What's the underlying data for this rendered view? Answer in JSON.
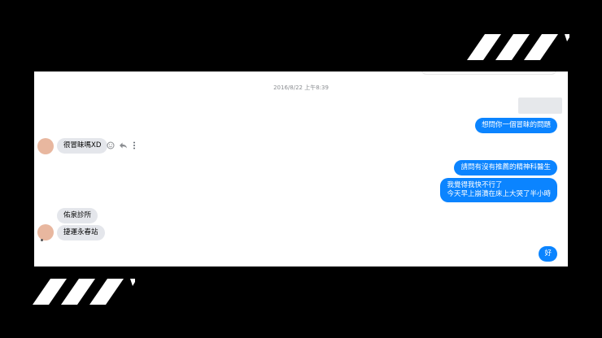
{
  "chat": {
    "timestamp": "2016/8/22 上午8:39",
    "messages": {
      "out1": "想問你一個冒昧的問題",
      "in1": "很冒昧嗎XD",
      "out2": "請問有沒有推薦的精神科醫生",
      "out3_line1": "我覺得我快不行了",
      "out3_line2": "今天早上崩潰在床上大哭了半小時",
      "in2": "佑泉診所",
      "in3": "捷運永春站",
      "out4": "好"
    }
  },
  "icons": {
    "emoji": "smiley-icon",
    "reply": "reply-arrow-icon",
    "more": "more-vertical-icon"
  },
  "colors": {
    "outgoing_bubble": "#0b84ff",
    "incoming_bubble": "#e4e6eb",
    "background": "#000000",
    "chat_background": "#ffffff",
    "avatar": "#e8b79f"
  }
}
